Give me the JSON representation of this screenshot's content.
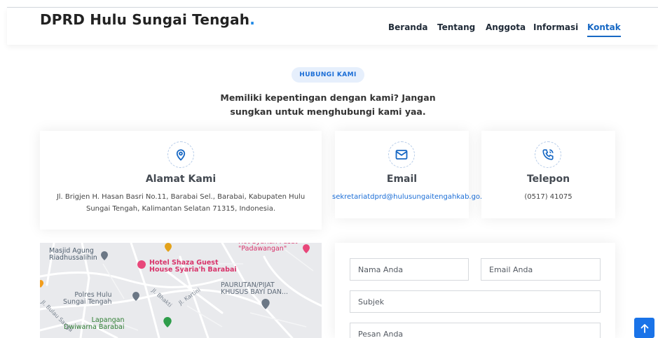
{
  "header": {
    "brand": "DPRD Hulu Sungai Tengah",
    "brand_dot": ".",
    "nav": [
      "Beranda",
      "Tentang",
      "Anggota",
      "Informasi",
      "Kontak"
    ],
    "active": "Kontak"
  },
  "hero": {
    "badge": "HUBUNGI KAMI",
    "subtitle": "Memiliki kepentingan dengan kami? Jangan sungkan untuk menghubungi kami yaa."
  },
  "cards": {
    "address": {
      "icon": "map-pin-icon",
      "title": "Alamat Kami",
      "text": "Jl. Brigjen H. Hasan Basri No.11, Barabai Sel., Barabai, Kabupaten Hulu Sungai Tengah, Kalimantan Selatan 71315, Indonesia."
    },
    "email": {
      "icon": "envelope-icon",
      "title": "Email",
      "text": "sekretariatdprd@hulusungaitengahkab.go.id"
    },
    "phone": {
      "icon": "phone-icon",
      "title": "Telepon",
      "text": "(0517) 41075"
    }
  },
  "map": {
    "labels": {
      "masjid": "Masjid Agung\nRiadhussalihin",
      "hotel": "Hotel Shaza Guest\nHouse Syaria'h Barabai",
      "top_right": "Hot Syariah Pusat\n\"Padawangan\"",
      "paurutan": "PAURUTAN/PIJAT\nKHUSUS BAYI DAN...",
      "polres": "Polres Hulu\nSungai Tengah",
      "lapangan": "Lapangan\nDwiwarna Barabai",
      "street_bhakti": "Jl. Bhakti",
      "street_kartini": "Jl. Kartini",
      "street_bulau": "Jl. Bulau Sanga"
    }
  },
  "form": {
    "name_placeholder": "Nama Anda",
    "email_placeholder": "Email Anda",
    "subject_placeholder": "Subjek",
    "message_placeholder": "Pesan Anda"
  },
  "colors": {
    "accent": "#1768c4",
    "badge_bg": "#e6effc",
    "scroll_button": "#1a73e8"
  }
}
